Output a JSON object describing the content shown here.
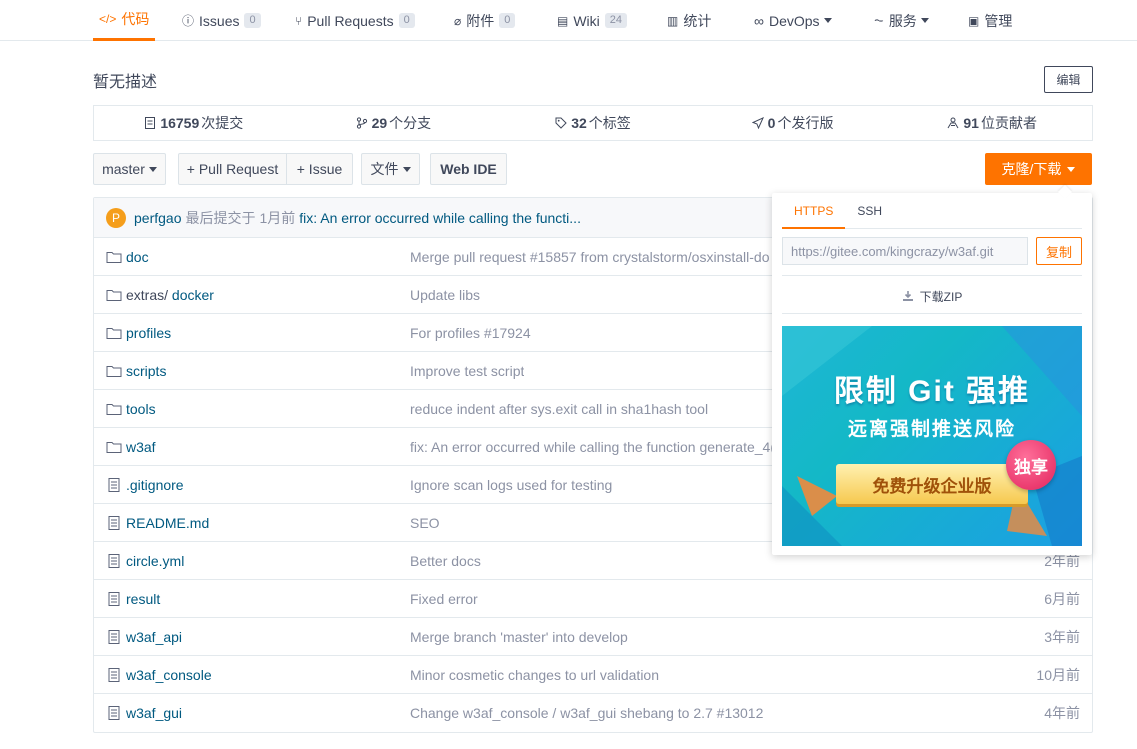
{
  "nav": {
    "tabs": [
      {
        "label": "代码",
        "icon": "code-icon",
        "active": true
      },
      {
        "label": "Issues",
        "icon": "issue-icon",
        "count": "0"
      },
      {
        "label": "Pull Requests",
        "icon": "pull-request-icon",
        "count": "0"
      },
      {
        "label": "附件",
        "icon": "attachment-icon",
        "count": "0"
      },
      {
        "label": "Wiki",
        "icon": "wiki-icon",
        "count": "24"
      },
      {
        "label": "统计",
        "icon": "stats-icon"
      },
      {
        "label": "DevOps",
        "icon": "devops-icon",
        "dropdown": true
      },
      {
        "label": "服务",
        "icon": "service-icon",
        "dropdown": true
      },
      {
        "label": "管理",
        "icon": "manage-icon"
      }
    ],
    "accent_color": "#fe7300"
  },
  "repo": {
    "description": "暂无描述",
    "edit_label": "编辑"
  },
  "stats": [
    {
      "value": "16759",
      "label": "次提交",
      "icon": "commit-icon"
    },
    {
      "value": "29",
      "label": "个分支",
      "icon": "branch-icon"
    },
    {
      "value": "32",
      "label": "个标签",
      "icon": "tag-icon"
    },
    {
      "value": "0",
      "label": "个发行版",
      "icon": "release-icon"
    },
    {
      "value": "91",
      "label": "位贡献者",
      "icon": "contributors-icon"
    }
  ],
  "toolbar": {
    "branch": "master",
    "pull_request": "+ Pull Request",
    "issue": "+ Issue",
    "file": "文件",
    "web_ide": "Web IDE",
    "clone": "克隆/下载"
  },
  "last_commit": {
    "avatar_letter": "P",
    "author": "perfgao",
    "prefix": "最后提交于",
    "time": "1月前",
    "message": "fix: An error occurred while calling the functi..."
  },
  "files": [
    {
      "type": "folder",
      "name": "doc",
      "message": "Merge pull request #15857 from crystalstorm/osxinstall-do",
      "time": ""
    },
    {
      "type": "folder",
      "prefix": "extras/ ",
      "name": "docker",
      "message": "Update libs",
      "time": ""
    },
    {
      "type": "folder",
      "name": "profiles",
      "message": "For profiles #17924",
      "time": ""
    },
    {
      "type": "folder",
      "name": "scripts",
      "message": "Improve test script",
      "time": ""
    },
    {
      "type": "folder",
      "name": "tools",
      "message": "reduce indent after sys.exit call in sha1hash tool",
      "time": ""
    },
    {
      "type": "folder",
      "name": "w3af",
      "message": "fix: An error occurred while calling the function generate_4(",
      "time": ""
    },
    {
      "type": "file",
      "name": ".gitignore",
      "message": "Ignore scan logs used for testing",
      "time": ""
    },
    {
      "type": "file",
      "name": "README.md",
      "message": "SEO",
      "time": ""
    },
    {
      "type": "file",
      "name": "circle.yml",
      "message": "Better docs",
      "time": "2年前"
    },
    {
      "type": "file",
      "name": "result",
      "message": "Fixed error",
      "time": "6月前"
    },
    {
      "type": "file",
      "name": "w3af_api",
      "message": "Merge branch 'master' into develop",
      "time": "3年前"
    },
    {
      "type": "file",
      "name": "w3af_console",
      "message": "Minor cosmetic changes to url validation",
      "time": "10月前"
    },
    {
      "type": "file",
      "name": "w3af_gui",
      "message": "Change w3af_console / w3af_gui shebang to 2.7 #13012",
      "time": "4年前"
    }
  ],
  "clone_popup": {
    "tab_https": "HTTPS",
    "tab_ssh": "SSH",
    "url": "https://gitee.com/kingcrazy/w3af.git",
    "copy_label": "复制",
    "zip_label": "下载ZIP",
    "banner": {
      "title": "限制 Git 强推",
      "subtitle": "远离强制推送风险",
      "cta": "免费升级企业版",
      "badge": "独享"
    }
  }
}
